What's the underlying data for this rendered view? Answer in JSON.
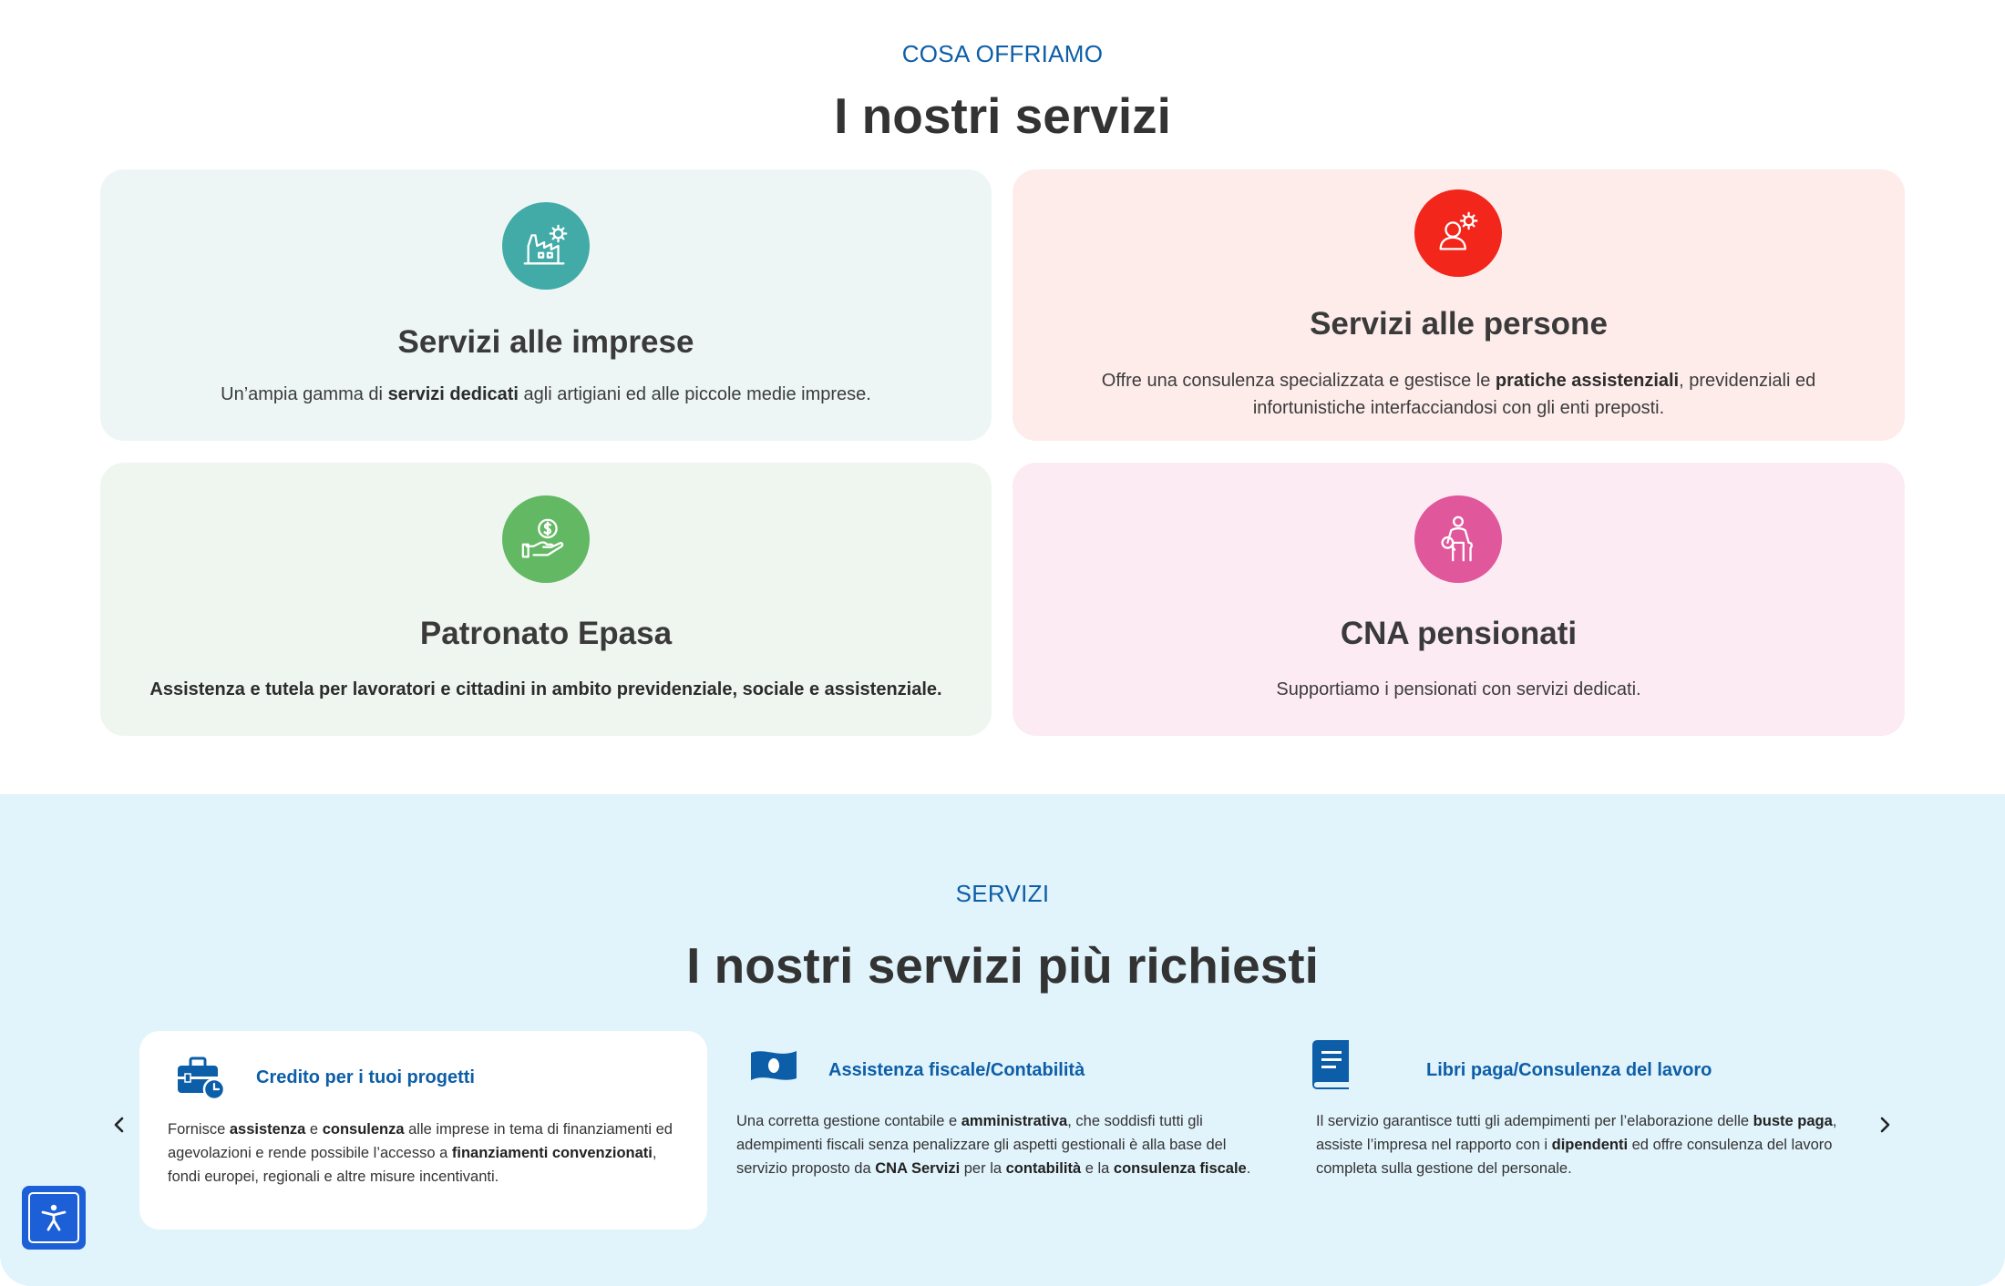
{
  "offer": {
    "eyebrow": "COSA OFFRIAMO",
    "title": "I nostri servizi",
    "cards": [
      {
        "title": "Servizi alle imprese",
        "icon": "factory-gear-icon",
        "bg": "#edf6f5",
        "icon_bg": "#42aba7",
        "text": [
          {
            "t": "Un’ampia gamma di ",
            "b": false
          },
          {
            "t": "servizi dedicati",
            "b": true
          },
          {
            "t": " agli artigiani ed alle piccole medie imprese.",
            "b": false
          }
        ]
      },
      {
        "title": "Servizi alle persone",
        "icon": "person-gear-icon",
        "bg": "#feeceb",
        "icon_bg": "#f2261b",
        "text": [
          {
            "t": "Offre una consulenza specializzata e gestisce le ",
            "b": false
          },
          {
            "t": "pratiche assistenziali",
            "b": true
          },
          {
            "t": ", previdenziali ed infortunistiche interfacciandosi con gli enti preposti.",
            "b": false
          }
        ]
      },
      {
        "title": "Patronato Epasa",
        "icon": "hand-coin-icon",
        "bg": "#eff6f0",
        "icon_bg": "#62b863",
        "text": [
          {
            "t": "Assistenza e tutela per lavoratori e cittadini in ambito previdenziale, sociale e assistenziale.",
            "b": true
          }
        ]
      },
      {
        "title": "CNA pensionati",
        "icon": "elderly-person-icon",
        "bg": "#fdebf3",
        "icon_bg": "#e0579b",
        "text": [
          {
            "t": "Supportiamo i pensionati con servizi dedicati.",
            "b": false
          }
        ]
      }
    ]
  },
  "services": {
    "eyebrow": "SERVIZI",
    "title": "I nostri servizi più richiesti",
    "items": [
      {
        "title": "Credito per i tuoi progetti",
        "icon": "briefcase-clock-icon",
        "text": [
          {
            "t": "Fornisce ",
            "b": false
          },
          {
            "t": "assistenza",
            "b": true
          },
          {
            "t": " e ",
            "b": false
          },
          {
            "t": "consulenza",
            "b": true
          },
          {
            "t": " alle imprese in tema di finanziamenti ed agevolazioni e rende possibile l’accesso a ",
            "b": false
          },
          {
            "t": "finanziamenti convenzionati",
            "b": true
          },
          {
            "t": ", fondi europei, regionali e altre misure incentivanti.",
            "b": false
          }
        ]
      },
      {
        "title": "Assistenza fiscale/Contabilità",
        "icon": "banknote-icon",
        "text": [
          {
            "t": "Una corretta gestione contabile e ",
            "b": false
          },
          {
            "t": "amministrativa",
            "b": true
          },
          {
            "t": ", che soddisfi tutti gli adempimenti fiscali senza penalizzare gli aspetti gestionali è alla base del servizio proposto da ",
            "b": false
          },
          {
            "t": "CNA Servizi",
            "b": true
          },
          {
            "t": " per la ",
            "b": false
          },
          {
            "t": "contabilità",
            "b": true
          },
          {
            "t": " e la ",
            "b": false
          },
          {
            "t": "consulenza fiscale",
            "b": true
          },
          {
            "t": ".",
            "b": false
          }
        ]
      },
      {
        "title": "Libri paga/Consulenza del lavoro",
        "icon": "book-icon",
        "text": [
          {
            "t": "Il servizio garantisce tutti gli adempimenti per l’elaborazione delle ",
            "b": false
          },
          {
            "t": "buste paga",
            "b": true
          },
          {
            "t": ", assiste l’impresa nel rapporto con i ",
            "b": false
          },
          {
            "t": "dipendenti",
            "b": true
          },
          {
            "t": " ed offre consulenza del lavoro completa sulla gestione del personale.",
            "b": false
          }
        ]
      }
    ],
    "prev_icon": "chevron-left-icon",
    "next_icon": "chevron-right-icon"
  },
  "accessibility": {
    "icon": "accessibility-icon",
    "color": "#1d5fd6"
  },
  "colors": {
    "accent": "#0d5ea8",
    "services_bg": "#e1f3fb"
  }
}
